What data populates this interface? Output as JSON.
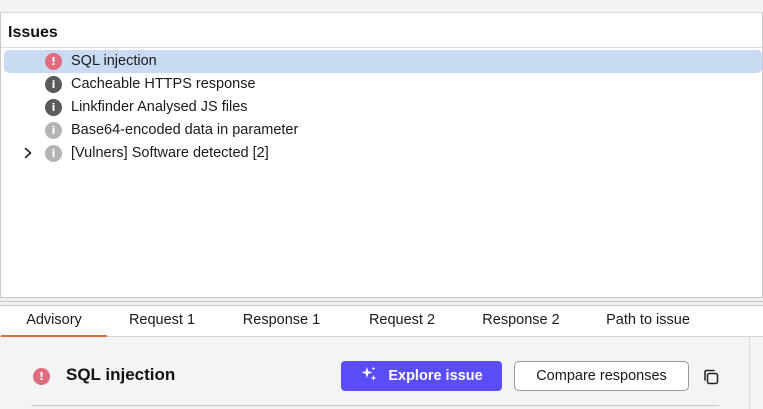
{
  "issues_panel": {
    "title": "Issues",
    "items": [
      {
        "label": "SQL injection",
        "severity_glyph": "!",
        "selected": true
      },
      {
        "label": "Cacheable HTTPS response",
        "severity_glyph": "i"
      },
      {
        "label": "Linkfinder Analysed JS files",
        "severity_glyph": "i"
      },
      {
        "label": "Base64-encoded data in parameter",
        "severity_glyph": "i"
      },
      {
        "label": "[Vulners] Software detected [2]",
        "severity_glyph": "i",
        "expandable": true
      }
    ]
  },
  "tabs": [
    {
      "label": "Advisory",
      "active": true
    },
    {
      "label": "Request 1"
    },
    {
      "label": "Response 1"
    },
    {
      "label": "Request 2"
    },
    {
      "label": "Response 2"
    },
    {
      "label": "Path to issue"
    }
  ],
  "advisory": {
    "title": "SQL injection",
    "severity_glyph": "!",
    "explore_label": "Explore issue",
    "compare_label": "Compare responses"
  },
  "icons": {
    "expand": "chevron-right-icon",
    "high": "exclamation-circle-icon",
    "info": "info-circle-icon",
    "explore": "sparkle-icon",
    "copy": "copy-icon"
  },
  "colors": {
    "selection": "#c9daf3",
    "severity_high": "#e36b7f",
    "severity_info_dark": "#5a5a5a",
    "severity_info_light": "#b4b4b4",
    "accent_button": "#5b4df5",
    "active_tab_underline": "#e8683f"
  }
}
